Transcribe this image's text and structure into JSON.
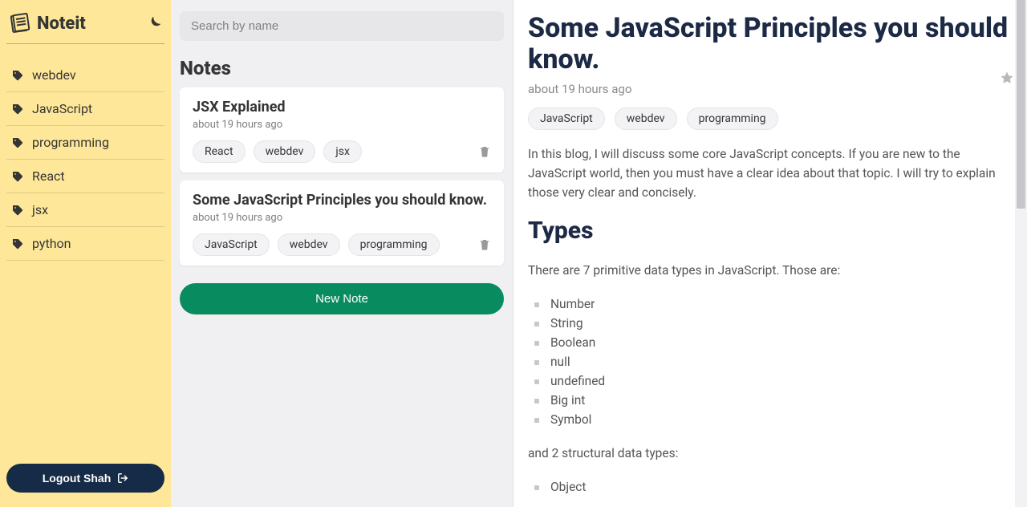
{
  "app": {
    "name": "Noteit"
  },
  "sidebar": {
    "tags": [
      "webdev",
      "JavaScript",
      "programming",
      "React",
      "jsx",
      "python"
    ],
    "logout": "Logout Shah"
  },
  "middle": {
    "search_placeholder": "Search by name",
    "heading": "Notes",
    "new_note": "New Note",
    "notes": [
      {
        "title": "JSX Explained",
        "time": "about 19 hours ago",
        "tags": [
          "React",
          "webdev",
          "jsx"
        ]
      },
      {
        "title": "Some JavaScript Principles you should know.",
        "time": "about 19 hours ago",
        "tags": [
          "JavaScript",
          "webdev",
          "programming"
        ]
      }
    ]
  },
  "content": {
    "title": "Some JavaScript Principles you should know.",
    "time": "about 19 hours ago",
    "tags": [
      "JavaScript",
      "webdev",
      "programming"
    ],
    "intro": "In this blog, I will discuss some core JavaScript concepts. If you are new to the JavaScript world, then you must have a clear idea about that topic. I will try to explain those very clear and concisely.",
    "section_heading": "Types",
    "paragraph1": "There are 7 primitive data types in JavaScript. Those are:",
    "list1": [
      "Number",
      "String",
      "Boolean",
      "null",
      "undefined",
      "Big int",
      "Symbol"
    ],
    "paragraph2": "and 2 structural data types:",
    "list2": [
      "Object"
    ]
  }
}
